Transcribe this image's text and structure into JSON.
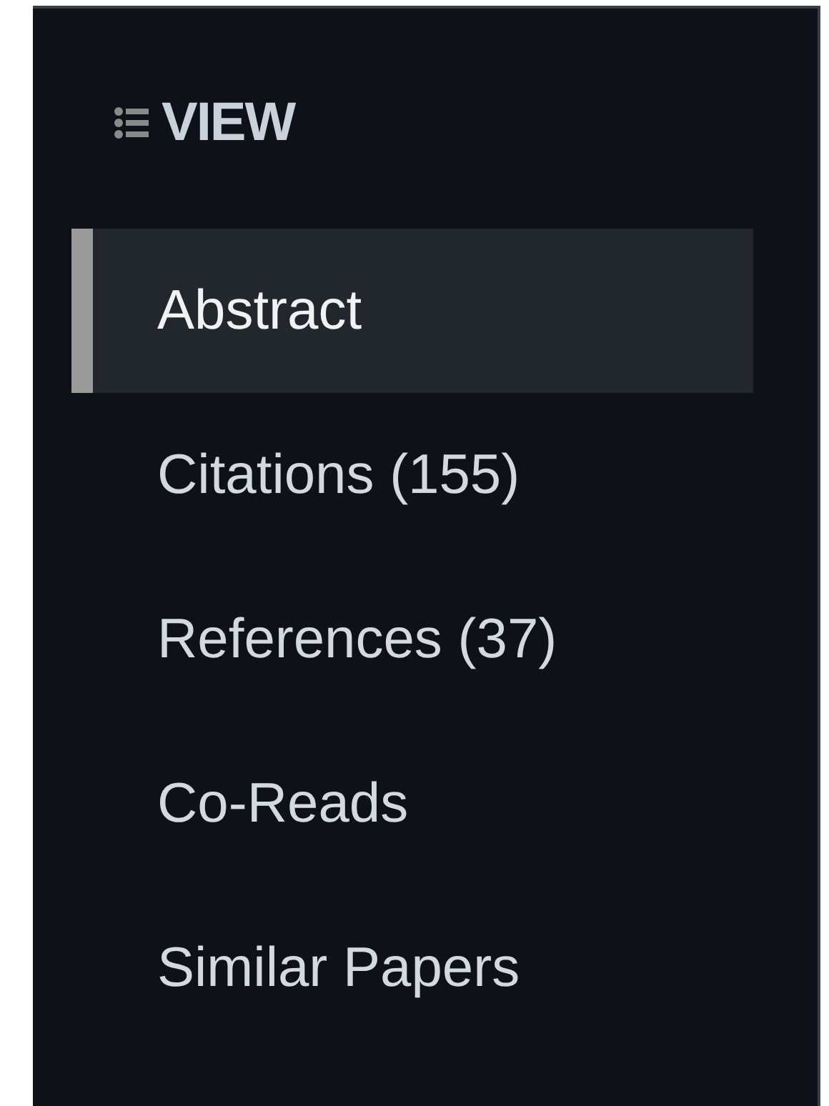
{
  "section": {
    "title": "VIEW"
  },
  "items": [
    {
      "label": "Abstract",
      "selected": true
    },
    {
      "label": "Citations (155)",
      "selected": false
    },
    {
      "label": "References (37)",
      "selected": false
    },
    {
      "label": "Co-Reads",
      "selected": false
    },
    {
      "label": "Similar Papers",
      "selected": false
    }
  ]
}
